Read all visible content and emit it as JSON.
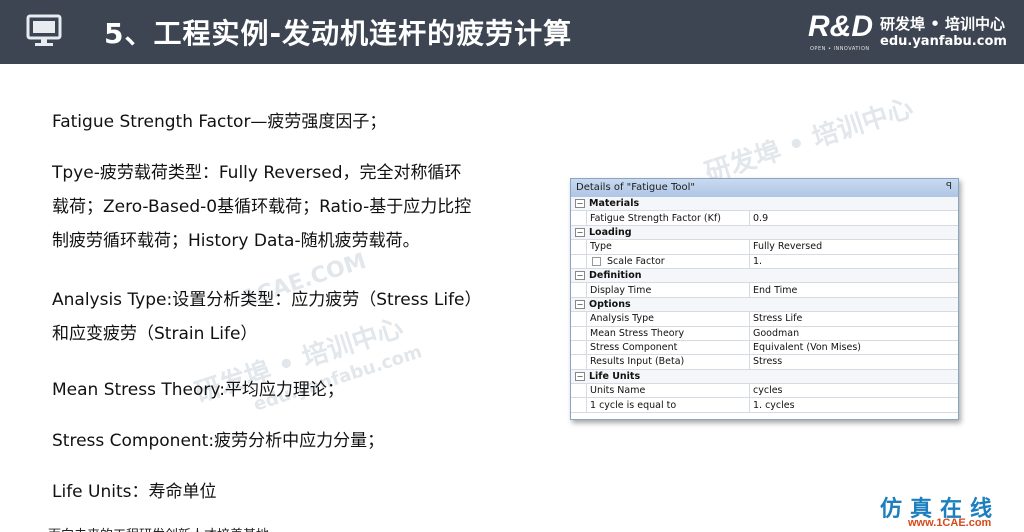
{
  "header": {
    "title": "5、工程实例-发动机连杆的疲劳计算",
    "logo": {
      "mark": "R&D",
      "name": "研发埠 • 培训中心",
      "url": "edu.yanfabu.com",
      "tagline": "OPEN • INNOVATION"
    }
  },
  "content": {
    "lines": [
      "Fatigue Strength Factor—疲劳强度因子；",
      "Tpye-疲劳载荷类型：Fully Reversed，完全对称循环",
      "载荷；Zero-Based-0基循环载荷；Ratio-基于应力比控",
      "制疲劳循环载荷；History Data-随机疲劳载荷。",
      "Analysis Type:设置分析类型：应力疲劳（Stress Life）",
      "和应变疲劳（Strain Life）",
      "Mean Stress Theory:平均应力理论；",
      "Stress Component:疲劳分析中应力分量；",
      "Life Units：寿命单位"
    ]
  },
  "panel": {
    "title": "Details of \"Fatigue Tool\"",
    "pin": "ꟼ",
    "sections": [
      {
        "label": "Materials",
        "toggle": "−",
        "rows": [
          {
            "name": "Fatigue Strength Factor (Kf)",
            "value": "0.9"
          }
        ]
      },
      {
        "label": "Loading",
        "toggle": "−",
        "rows": [
          {
            "name": "Type",
            "value": "Fully Reversed"
          },
          {
            "name": "Scale Factor",
            "value": "1."
          }
        ]
      },
      {
        "label": "Definition",
        "toggle": "−",
        "rows": [
          {
            "name": "Display Time",
            "value": "End Time"
          }
        ]
      },
      {
        "label": "Options",
        "toggle": "−",
        "rows": [
          {
            "name": "Analysis Type",
            "value": "Stress Life"
          },
          {
            "name": "Mean Stress Theory",
            "value": "Goodman"
          },
          {
            "name": "Stress Component",
            "value": "Equivalent (Von Mises)"
          },
          {
            "name": "Results Input (Beta)",
            "value": "Stress"
          }
        ]
      },
      {
        "label": "Life Units",
        "toggle": "−",
        "rows": [
          {
            "name": "Units Name",
            "value": "cycles"
          },
          {
            "name": "1 cycle is equal to",
            "value": "1. cycles"
          }
        ]
      }
    ]
  },
  "watermarks": {
    "cn": "研发埠 • 培训中心",
    "url": "edu.yanfabu.com",
    "site": "1CAE.COM"
  },
  "footer": {
    "text": "面向未来的工程研发创新人才培养基地",
    "brand": "仿真在线",
    "brand_url": "www.1CAE.com"
  }
}
